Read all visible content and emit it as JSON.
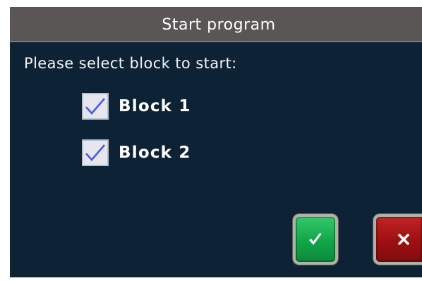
{
  "dialog": {
    "title": "Start program",
    "prompt": "Please select block to start:",
    "options": [
      {
        "label": "Block 1",
        "checked": true
      },
      {
        "label": "Block 2",
        "checked": true
      }
    ],
    "buttons": {
      "confirm_icon": "checkmark-icon",
      "cancel_icon": "close-icon"
    }
  },
  "colors": {
    "dialog_background": "#0d2235",
    "titlebar": "#5a5656",
    "confirm_button": "#12a548",
    "cancel_button": "#9d0f12",
    "checkmark": "#4a5ae6"
  }
}
